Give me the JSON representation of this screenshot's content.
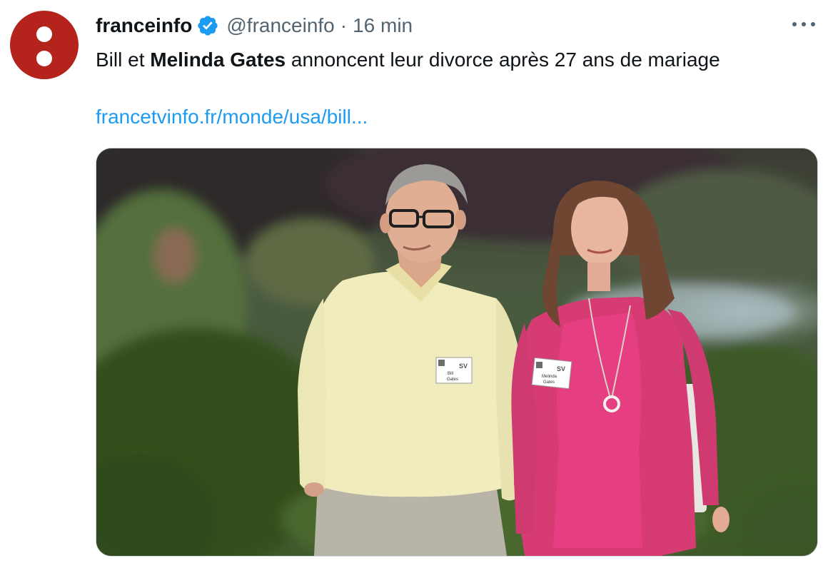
{
  "tweet": {
    "display_name": "franceinfo",
    "handle": "@franceinfo",
    "separator": "·",
    "time": "16 min",
    "text_part1": "Bill et ",
    "text_bold": "Melinda Gates",
    "text_part2": " annoncent leur divorce après 27 ans de mariage",
    "link_text": "francetvinfo.fr/monde/usa/bill...",
    "badge_1_line1": "Bill",
    "badge_1_line2": "Gates",
    "badge_2_line1": "Melinda",
    "badge_2_line2": "Gates",
    "badge_logo": "SV"
  },
  "colors": {
    "avatar": "#b5241c",
    "verified": "#1d9bf0",
    "link": "#1d9bf0",
    "muted": "#536471"
  },
  "icons": {
    "verified": "verified-badge-icon",
    "more": "more-horizontal-icon"
  }
}
